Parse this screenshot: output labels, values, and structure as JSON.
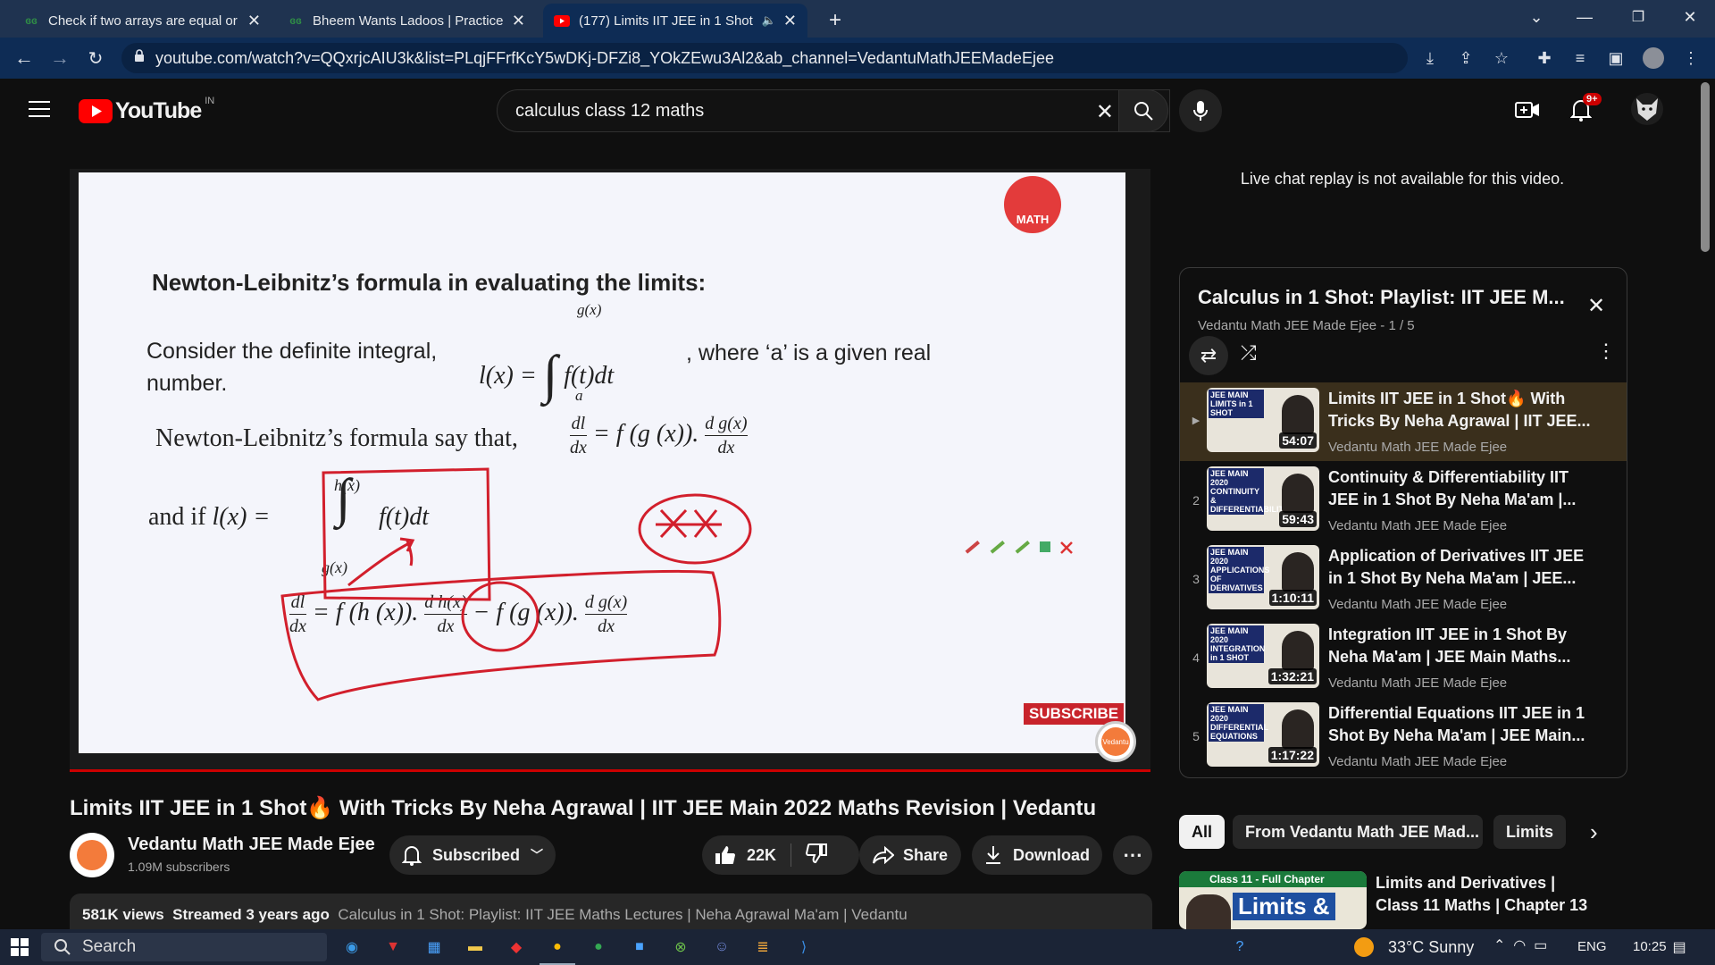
{
  "browser": {
    "tabs": [
      {
        "title": "Check if two arrays are equal or r",
        "icon": "gfg-icon"
      },
      {
        "title": "Bheem Wants Ladoos | Practice |",
        "icon": "gfg-icon"
      },
      {
        "title": "(177) Limits IIT JEE in 1 Shot🔥",
        "icon": "youtube-icon"
      }
    ],
    "new_tab": "+",
    "url": "youtube.com/watch?v=QQxrjcAIU3k&list=PLqjFFrfKcY5wDKj-DFZi8_YOkZEwu3Al2&ab_channel=VedantuMathJEEMadeEjee"
  },
  "youtube": {
    "logo": "YouTube",
    "region": "IN",
    "search_value": "calculus class 12 maths",
    "notifications": "9+"
  },
  "slide": {
    "heading": "Newton-Leibnitz’s formula in evaluating the limits:",
    "line1_a": "Consider the definite integral,",
    "line1_b": ", where ‘a’ is a given real",
    "line1_c": "number.",
    "line2": "Newton-Leibnitz’s formula say that,",
    "and_if": "and  if",
    "brand": "MATH",
    "subscribe": "SUBSCRIBE",
    "watermark": "Vedantu"
  },
  "video": {
    "title": "Limits IIT JEE in 1 Shot🔥 With Tricks By Neha Agrawal | IIT JEE Main 2022 Maths Revision | Vedantu",
    "channel": "Vedantu Math JEE Made Ejee",
    "subscribers": "1.09M subscribers",
    "subscribed": "Subscribed",
    "likes": "22K",
    "share": "Share",
    "download": "Download",
    "views": "581K views",
    "streamed": "Streamed 3 years ago",
    "desc": "Calculus in 1 Shot: Playlist: IIT JEE Maths Lectures | Neha Agrawal Ma'am | Vedantu"
  },
  "live_chat": "Live chat replay is not available for this video.",
  "playlist": {
    "title": "Calculus in 1 Shot: Playlist: IIT JEE M...",
    "sub": "Vedantu Math JEE Made Ejee - 1 / 5",
    "items": [
      {
        "num": "▶",
        "title": "Limits IIT JEE in 1 Shot🔥 With Tricks By Neha Agrawal | IIT JEE...",
        "channel": "Vedantu Math JEE Made Ejee",
        "dur": "54:07",
        "thumb": "JEE MAIN LIMITS in 1 SHOT"
      },
      {
        "num": "2",
        "title": "Continuity & Differentiability IIT JEE in 1 Shot By Neha Ma'am |...",
        "channel": "Vedantu Math JEE Made Ejee",
        "dur": "59:43",
        "thumb": "JEE MAIN 2020 CONTINUITY & DIFFERENTIABILITY"
      },
      {
        "num": "3",
        "title": "Application of Derivatives IIT JEE in 1 Shot By Neha Ma'am | JEE...",
        "channel": "Vedantu Math JEE Made Ejee",
        "dur": "1:10:11",
        "thumb": "JEE MAIN 2020 APPLICATIONS OF DERIVATIVES"
      },
      {
        "num": "4",
        "title": "Integration IIT JEE in 1 Shot By Neha Ma'am | JEE Main Maths...",
        "channel": "Vedantu Math JEE Made Ejee",
        "dur": "1:32:21",
        "thumb": "JEE MAIN 2020 INTEGRATION in 1 SHOT"
      },
      {
        "num": "5",
        "title": "Differential Equations IIT JEE in 1 Shot By Neha Ma'am | JEE Main...",
        "channel": "Vedantu Math JEE Made Ejee",
        "dur": "1:17:22",
        "thumb": "JEE MAIN 2020 DIFFERENTIAL EQUATIONS"
      }
    ]
  },
  "chips": [
    "All",
    "From Vedantu Math JEE Mad...",
    "Limits"
  ],
  "recommended": {
    "title": "Limits and Derivatives | Class 11 Maths | Chapter 13",
    "thumb_banner": "Class 11 - Full Chapter",
    "thumb_text": "Limits &"
  },
  "taskbar": {
    "search": "Search",
    "weather": "33°C  Sunny",
    "lang": "ENG",
    "time": "10:25"
  }
}
